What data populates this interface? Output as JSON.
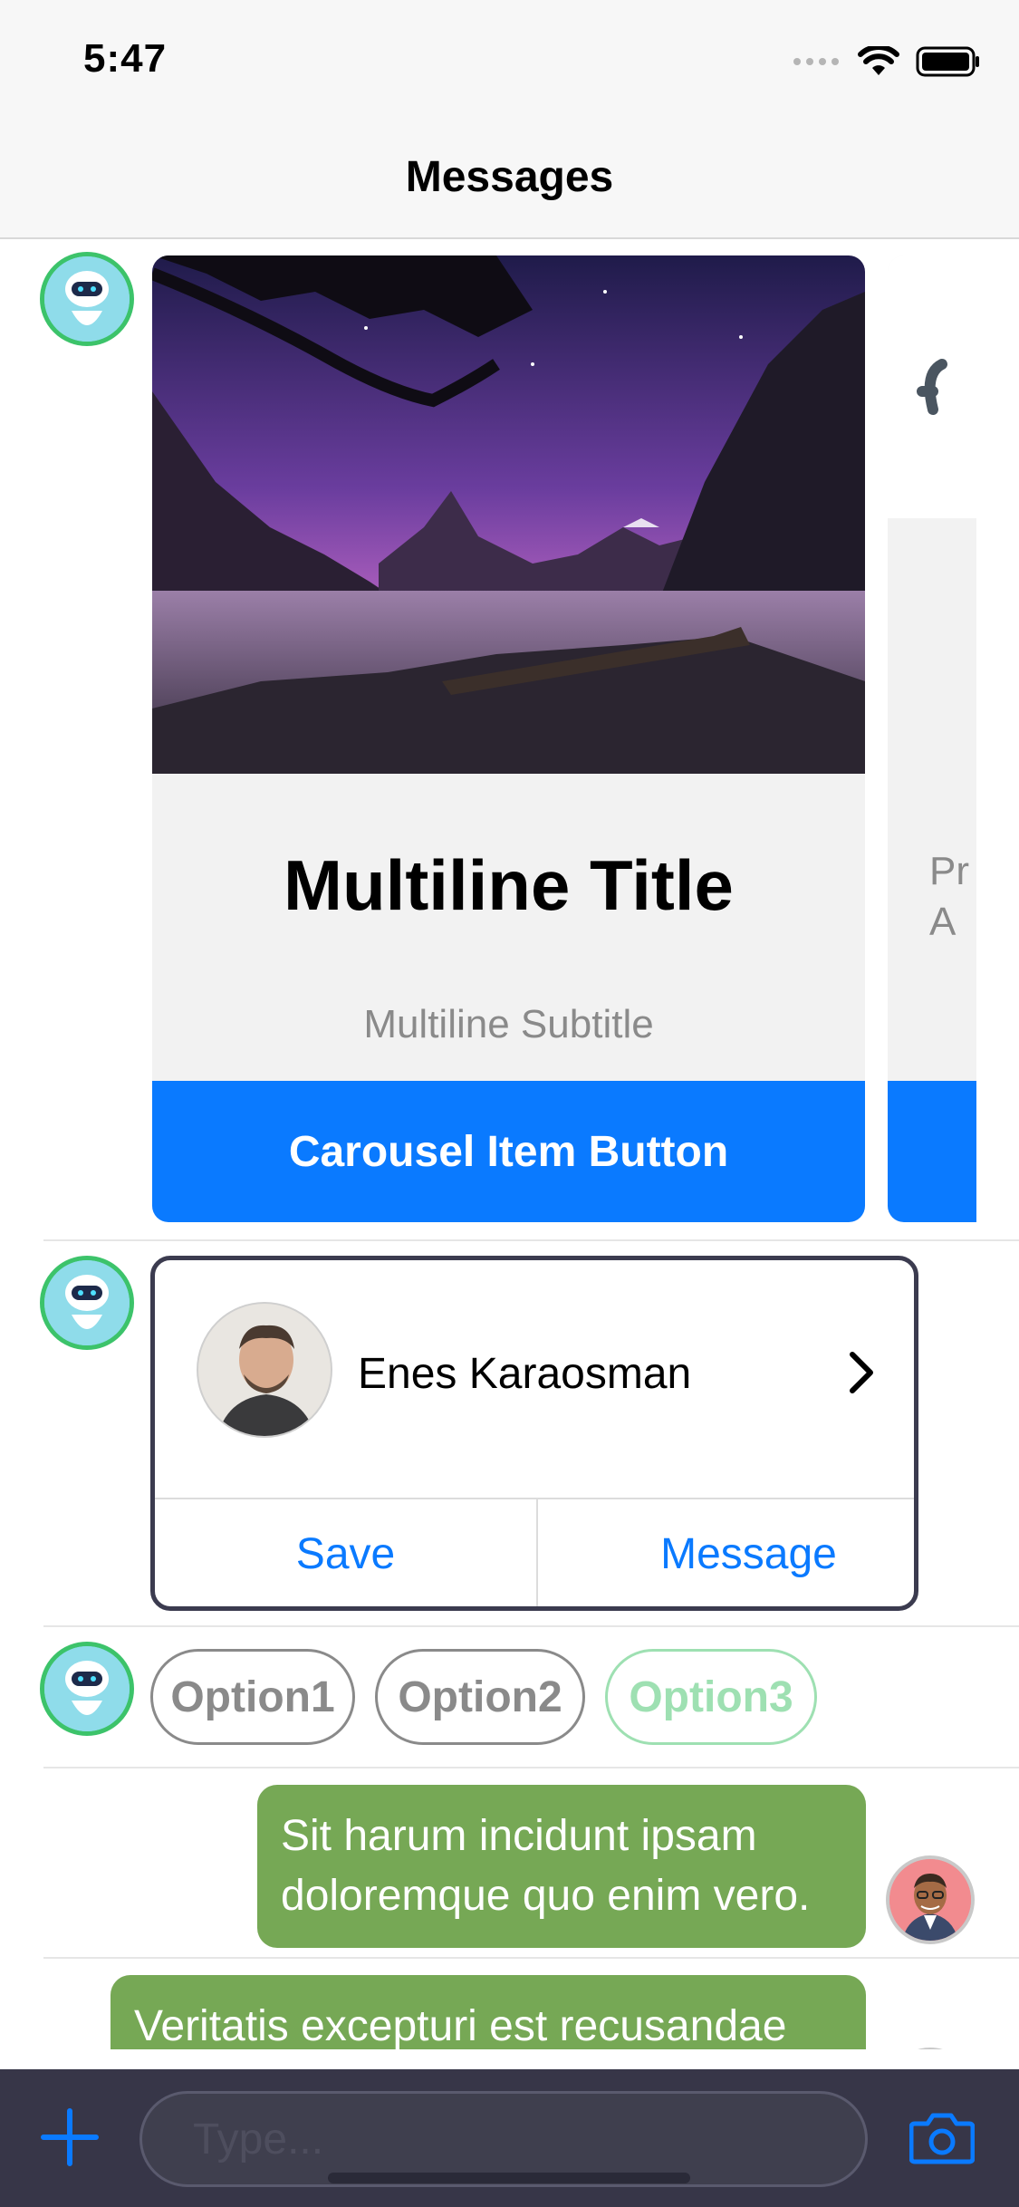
{
  "status_bar": {
    "time": "5:47"
  },
  "nav": {
    "title": "Messages"
  },
  "carousel": {
    "items": [
      {
        "title": "Multiline Title",
        "subtitle": "Multiline Subtitle",
        "button": "Carousel Item Button"
      },
      {
        "subtitle_partial": "Pr\nA"
      }
    ]
  },
  "contact_card": {
    "name": "Enes Karaosman",
    "save_label": "Save",
    "message_label": "Message"
  },
  "quick_replies": [
    {
      "label": "Option1",
      "selected": false
    },
    {
      "label": "Option2",
      "selected": false
    },
    {
      "label": "Option3",
      "selected": true
    }
  ],
  "messages": [
    {
      "text": "Sit harum incidunt ipsam doloremque quo enim vero.",
      "from": "user"
    },
    {
      "text": "Veritatis excepturi est recusandae",
      "from": "user"
    }
  ],
  "input": {
    "placeholder": "Type..."
  },
  "colors": {
    "accent": "#0a7aff",
    "bubble": "#76a855",
    "bot_ring": "#3cc36a",
    "input_bar": "#373648"
  }
}
